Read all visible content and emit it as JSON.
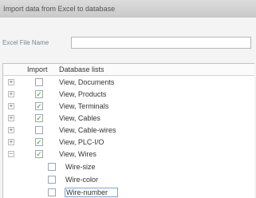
{
  "window": {
    "title": "Import data from Excel to database"
  },
  "file": {
    "label": "Excel File Name",
    "value": ""
  },
  "table": {
    "headers": {
      "import": "Import",
      "lists": "Database lists"
    },
    "rows": [
      {
        "expander": "+",
        "checked": false,
        "label": "View, Documents"
      },
      {
        "expander": "+",
        "checked": true,
        "label": "View, Products"
      },
      {
        "expander": "+",
        "checked": true,
        "label": "View, Terminals"
      },
      {
        "expander": "+",
        "checked": true,
        "label": "View, Cables"
      },
      {
        "expander": "+",
        "checked": false,
        "label": "View, Cable-wires"
      },
      {
        "expander": "+",
        "checked": true,
        "label": "View, PLC-I/O"
      },
      {
        "expander": "−",
        "checked": true,
        "label": "View, Wires"
      }
    ],
    "subrows": [
      {
        "checked": false,
        "label": "Wire-size"
      },
      {
        "checked": false,
        "label": "Wire-color"
      },
      {
        "checked": false,
        "label": "Wire-number"
      }
    ]
  },
  "icons": {
    "expand": "plus-square-icon",
    "collapse": "minus-square-icon",
    "check": "check-icon"
  }
}
